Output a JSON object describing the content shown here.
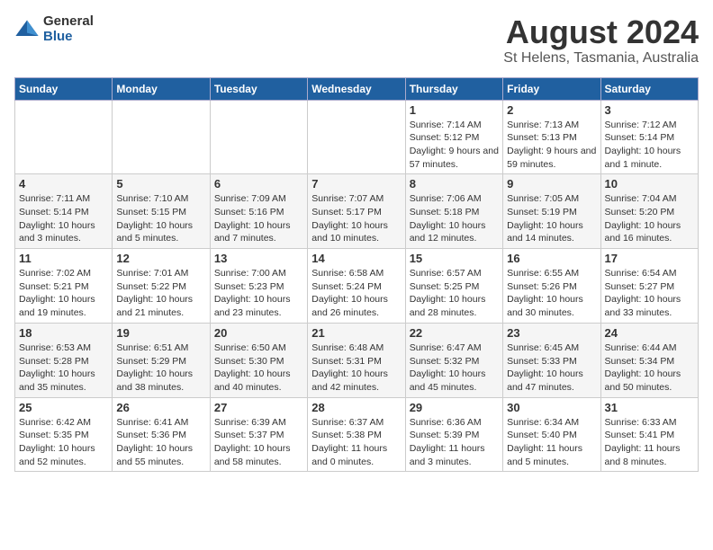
{
  "logo": {
    "general": "General",
    "blue": "Blue"
  },
  "header": {
    "title": "August 2024",
    "subtitle": "St Helens, Tasmania, Australia"
  },
  "weekdays": [
    "Sunday",
    "Monday",
    "Tuesday",
    "Wednesday",
    "Thursday",
    "Friday",
    "Saturday"
  ],
  "weeks": [
    [
      {
        "day": "",
        "info": ""
      },
      {
        "day": "",
        "info": ""
      },
      {
        "day": "",
        "info": ""
      },
      {
        "day": "",
        "info": ""
      },
      {
        "day": "1",
        "info": "Sunrise: 7:14 AM\nSunset: 5:12 PM\nDaylight: 9 hours and 57 minutes."
      },
      {
        "day": "2",
        "info": "Sunrise: 7:13 AM\nSunset: 5:13 PM\nDaylight: 9 hours and 59 minutes."
      },
      {
        "day": "3",
        "info": "Sunrise: 7:12 AM\nSunset: 5:14 PM\nDaylight: 10 hours and 1 minute."
      }
    ],
    [
      {
        "day": "4",
        "info": "Sunrise: 7:11 AM\nSunset: 5:14 PM\nDaylight: 10 hours and 3 minutes."
      },
      {
        "day": "5",
        "info": "Sunrise: 7:10 AM\nSunset: 5:15 PM\nDaylight: 10 hours and 5 minutes."
      },
      {
        "day": "6",
        "info": "Sunrise: 7:09 AM\nSunset: 5:16 PM\nDaylight: 10 hours and 7 minutes."
      },
      {
        "day": "7",
        "info": "Sunrise: 7:07 AM\nSunset: 5:17 PM\nDaylight: 10 hours and 10 minutes."
      },
      {
        "day": "8",
        "info": "Sunrise: 7:06 AM\nSunset: 5:18 PM\nDaylight: 10 hours and 12 minutes."
      },
      {
        "day": "9",
        "info": "Sunrise: 7:05 AM\nSunset: 5:19 PM\nDaylight: 10 hours and 14 minutes."
      },
      {
        "day": "10",
        "info": "Sunrise: 7:04 AM\nSunset: 5:20 PM\nDaylight: 10 hours and 16 minutes."
      }
    ],
    [
      {
        "day": "11",
        "info": "Sunrise: 7:02 AM\nSunset: 5:21 PM\nDaylight: 10 hours and 19 minutes."
      },
      {
        "day": "12",
        "info": "Sunrise: 7:01 AM\nSunset: 5:22 PM\nDaylight: 10 hours and 21 minutes."
      },
      {
        "day": "13",
        "info": "Sunrise: 7:00 AM\nSunset: 5:23 PM\nDaylight: 10 hours and 23 minutes."
      },
      {
        "day": "14",
        "info": "Sunrise: 6:58 AM\nSunset: 5:24 PM\nDaylight: 10 hours and 26 minutes."
      },
      {
        "day": "15",
        "info": "Sunrise: 6:57 AM\nSunset: 5:25 PM\nDaylight: 10 hours and 28 minutes."
      },
      {
        "day": "16",
        "info": "Sunrise: 6:55 AM\nSunset: 5:26 PM\nDaylight: 10 hours and 30 minutes."
      },
      {
        "day": "17",
        "info": "Sunrise: 6:54 AM\nSunset: 5:27 PM\nDaylight: 10 hours and 33 minutes."
      }
    ],
    [
      {
        "day": "18",
        "info": "Sunrise: 6:53 AM\nSunset: 5:28 PM\nDaylight: 10 hours and 35 minutes."
      },
      {
        "day": "19",
        "info": "Sunrise: 6:51 AM\nSunset: 5:29 PM\nDaylight: 10 hours and 38 minutes."
      },
      {
        "day": "20",
        "info": "Sunrise: 6:50 AM\nSunset: 5:30 PM\nDaylight: 10 hours and 40 minutes."
      },
      {
        "day": "21",
        "info": "Sunrise: 6:48 AM\nSunset: 5:31 PM\nDaylight: 10 hours and 42 minutes."
      },
      {
        "day": "22",
        "info": "Sunrise: 6:47 AM\nSunset: 5:32 PM\nDaylight: 10 hours and 45 minutes."
      },
      {
        "day": "23",
        "info": "Sunrise: 6:45 AM\nSunset: 5:33 PM\nDaylight: 10 hours and 47 minutes."
      },
      {
        "day": "24",
        "info": "Sunrise: 6:44 AM\nSunset: 5:34 PM\nDaylight: 10 hours and 50 minutes."
      }
    ],
    [
      {
        "day": "25",
        "info": "Sunrise: 6:42 AM\nSunset: 5:35 PM\nDaylight: 10 hours and 52 minutes."
      },
      {
        "day": "26",
        "info": "Sunrise: 6:41 AM\nSunset: 5:36 PM\nDaylight: 10 hours and 55 minutes."
      },
      {
        "day": "27",
        "info": "Sunrise: 6:39 AM\nSunset: 5:37 PM\nDaylight: 10 hours and 58 minutes."
      },
      {
        "day": "28",
        "info": "Sunrise: 6:37 AM\nSunset: 5:38 PM\nDaylight: 11 hours and 0 minutes."
      },
      {
        "day": "29",
        "info": "Sunrise: 6:36 AM\nSunset: 5:39 PM\nDaylight: 11 hours and 3 minutes."
      },
      {
        "day": "30",
        "info": "Sunrise: 6:34 AM\nSunset: 5:40 PM\nDaylight: 11 hours and 5 minutes."
      },
      {
        "day": "31",
        "info": "Sunrise: 6:33 AM\nSunset: 5:41 PM\nDaylight: 11 hours and 8 minutes."
      }
    ]
  ]
}
